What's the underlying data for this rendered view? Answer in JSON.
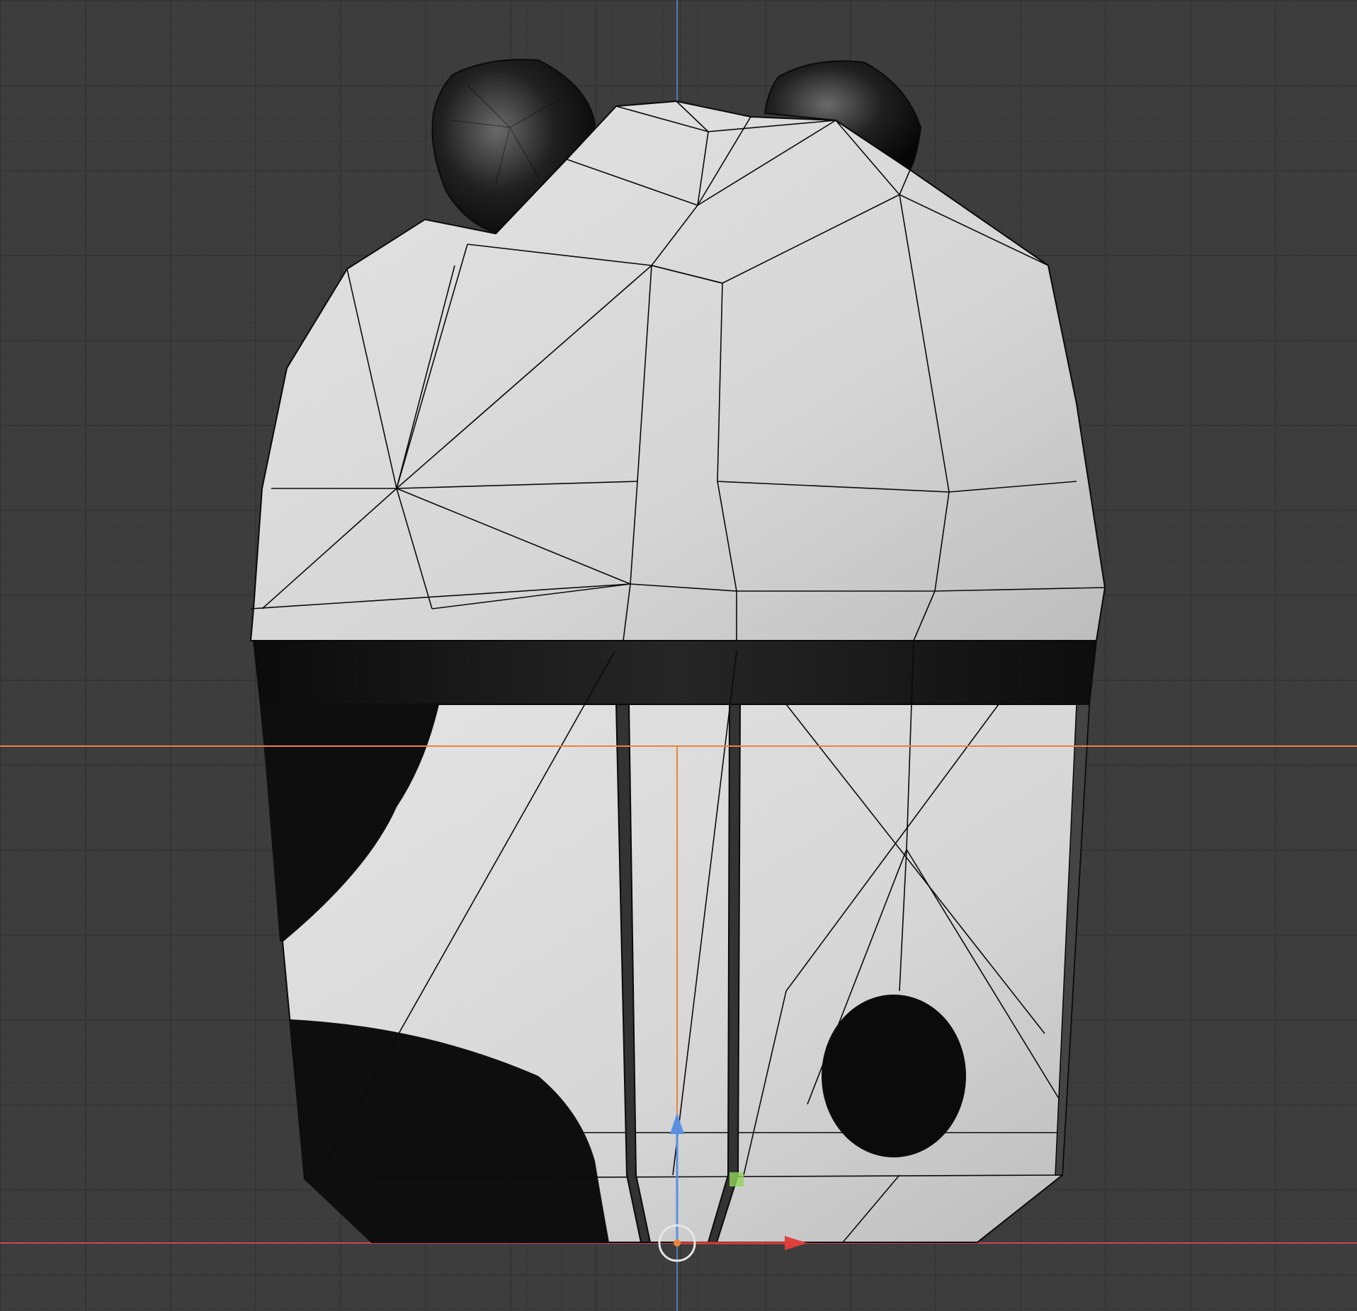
{
  "viewport": {
    "background": "#3d3d3d",
    "grid_minor": "#393939",
    "grid_major": "#353535"
  },
  "axes": {
    "x_axis_color": "#d0444f",
    "y_axis_color": "#5d86d6",
    "selection_line_color": "#e8853a"
  },
  "model": {
    "object": "panda-box",
    "body_color": "#d8d8d8",
    "stripe_color": "#111111",
    "edge_color": "#0a0a0a"
  },
  "gizmo": {
    "x_arrow_color": "#e0403c",
    "z_arrow_color": "#5a8fe0",
    "origin_ring_color": "#e6e6e6",
    "pivot_handle_color": "#8fd45a"
  }
}
